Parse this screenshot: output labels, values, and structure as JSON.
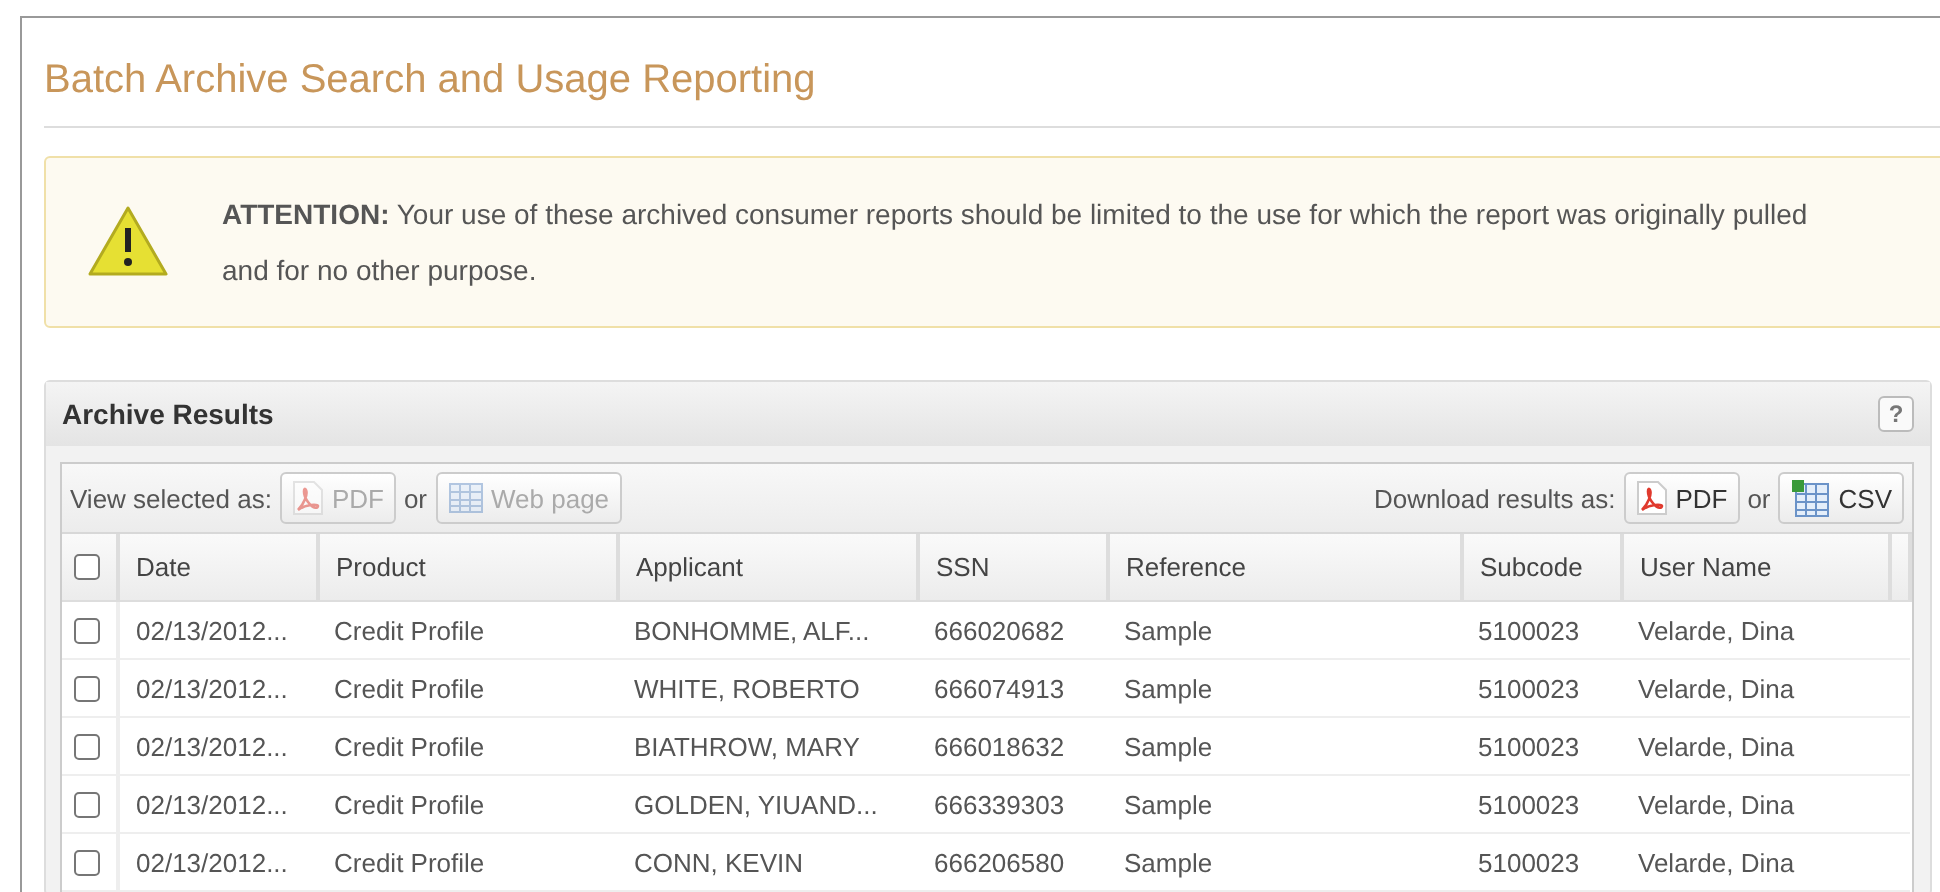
{
  "title": "Batch Archive Search and Usage Reporting",
  "notice": {
    "label": "ATTENTION:",
    "text": "Your use of these archived consumer reports should be limited to the use for which the report was originally pulled and for no other purpose."
  },
  "panel": {
    "title": "Archive Results",
    "help": "?"
  },
  "toolbar": {
    "view_label": "View selected as:",
    "view_buttons": [
      {
        "kind": "pdf",
        "label": "PDF",
        "disabled": true
      },
      {
        "kind": "web",
        "label": "Web page",
        "disabled": true
      }
    ],
    "view_or": "or",
    "download_label": "Download results as:",
    "download_buttons": [
      {
        "kind": "pdf",
        "label": "PDF",
        "disabled": false
      },
      {
        "kind": "csv",
        "label": "CSV",
        "disabled": false
      }
    ],
    "download_or": "or"
  },
  "table": {
    "select_all": {
      "checked": false
    },
    "columns": [
      "Date",
      "Product",
      "Applicant",
      "SSN",
      "Reference",
      "Subcode",
      "User Name"
    ],
    "rows": [
      {
        "checked": false,
        "cells": [
          "02/13/2012...",
          "Credit Profile",
          "BONHOMME, ALF...",
          "666020682",
          "Sample",
          "5100023",
          "Velarde, Dina"
        ]
      },
      {
        "checked": false,
        "cells": [
          "02/13/2012...",
          "Credit Profile",
          "WHITE, ROBERTO",
          "666074913",
          "Sample",
          "5100023",
          "Velarde, Dina"
        ]
      },
      {
        "checked": false,
        "cells": [
          "02/13/2012...",
          "Credit Profile",
          "BIATHROW, MARY",
          "666018632",
          "Sample",
          "5100023",
          "Velarde, Dina"
        ]
      },
      {
        "checked": false,
        "cells": [
          "02/13/2012...",
          "Credit Profile",
          "GOLDEN, YIUAND...",
          "666339303",
          "Sample",
          "5100023",
          "Velarde, Dina"
        ]
      },
      {
        "checked": false,
        "cells": [
          "02/13/2012...",
          "Credit Profile",
          "CONN, KEVIN",
          "666206580",
          "Sample",
          "5100023",
          "Velarde, Dina"
        ]
      }
    ]
  }
}
